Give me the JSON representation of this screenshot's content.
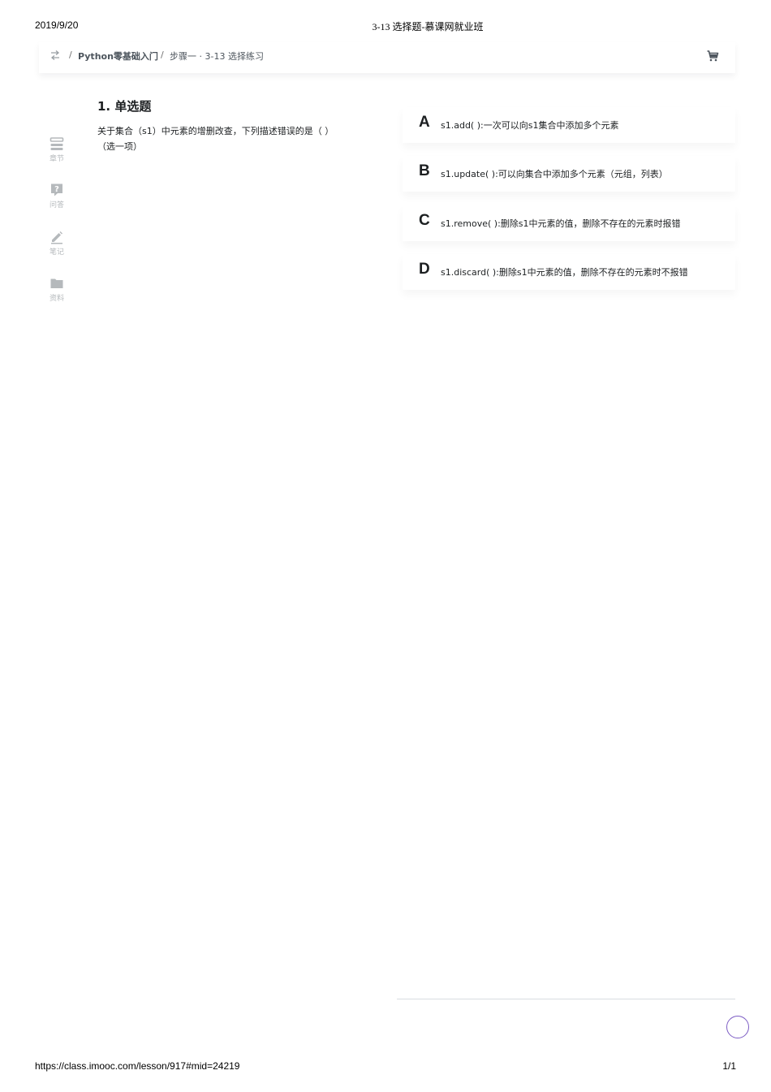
{
  "print": {
    "date": "2019/9/20",
    "title": "3-13 选择题-慕课网就业班",
    "url": "https://class.imooc.com/lesson/917#mid=24219",
    "page": "1/1"
  },
  "nav": {
    "separator": "/",
    "course": "Python零基础入门",
    "lesson": "步骤一 · 3-13 选择练习",
    "back_icon": "switch-arrows-icon",
    "cart_icon": "cart-icon"
  },
  "sidebar": {
    "items": [
      {
        "label": "章节",
        "icon": "chapters-icon"
      },
      {
        "label": "问答",
        "icon": "question-icon"
      },
      {
        "label": "笔记",
        "icon": "pencil-icon"
      },
      {
        "label": "资料",
        "icon": "folder-icon"
      }
    ]
  },
  "question": {
    "title": "1. 单选题",
    "text": "关于集合（s1）中元素的增删改查，下列描述错误的是（   ）（选一项）"
  },
  "options": [
    {
      "letter": "A",
      "text": "s1.add(   ):一次可以向s1集合中添加多个元素"
    },
    {
      "letter": "B",
      "text": "s1.update(   ):可以向集合中添加多个元素（元组，列表）"
    },
    {
      "letter": "C",
      "text": "s1.remove(   ):删除s1中元素的值，删除不存在的元素时报错"
    },
    {
      "letter": "D",
      "text": "s1.discard(   ):删除s1中元素的值，删除不存在的元素时不报错"
    }
  ],
  "colors": {
    "accent": "#7c5cc4",
    "text": "#1c1f21",
    "muted": "#b5b9bc"
  }
}
